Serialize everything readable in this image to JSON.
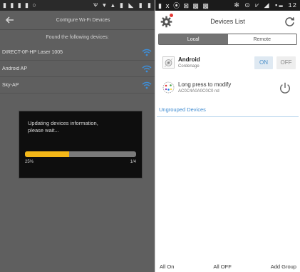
{
  "left": {
    "statusbar": {
      "left": "▮ ▮ ▮ ▮ ○",
      "right": "Ѱ ▾ ▴ ▮ ◣ ▮ ▮"
    },
    "title": "Configure Wi-Fi Devices",
    "subtitle": "Found the following devices:",
    "wifi_networks": [
      {
        "name": "DIRECT-0F-HP Laser 1005"
      },
      {
        "name": "Android AP"
      },
      {
        "name": "Sky-AP"
      }
    ],
    "wifi_colors": [
      "#3e8ed8",
      "#3e8ed8",
      "#3e8ed8"
    ],
    "dialog": {
      "message": "Updating devices information, please wait...",
      "progress_fraction": 0.4,
      "progress_left": "25%",
      "progress_right": "1/4"
    }
  },
  "right": {
    "statusbar": {
      "left": "▮ ⅹ ⦿ ⊠ ▩ ▩",
      "right": "✻ ⊙ ⩗ ◢ ▪▬ 12"
    },
    "title": "Devices List",
    "tabs": [
      {
        "label": "Local",
        "active": true
      },
      {
        "label": "Remote",
        "active": false
      }
    ],
    "devices": [
      {
        "name": "Android",
        "subtitle": "Cordenage",
        "on_label": "ON",
        "off_label": "OFF"
      },
      {
        "name": "Long press to modify",
        "subtitle": "AC0C4A0A0C0C0 nd"
      }
    ],
    "ungrouped_label": "Ungrouped Devices",
    "bottom_actions": [
      {
        "label": "All On"
      },
      {
        "label": "All OFF"
      },
      {
        "label": "Add Group"
      }
    ],
    "accent_color": "#3d8ad0",
    "badge_color": "#e53935",
    "gear_icon": "gear-icon",
    "refresh_icon": "refresh-icon",
    "power_icon": "power-icon"
  }
}
